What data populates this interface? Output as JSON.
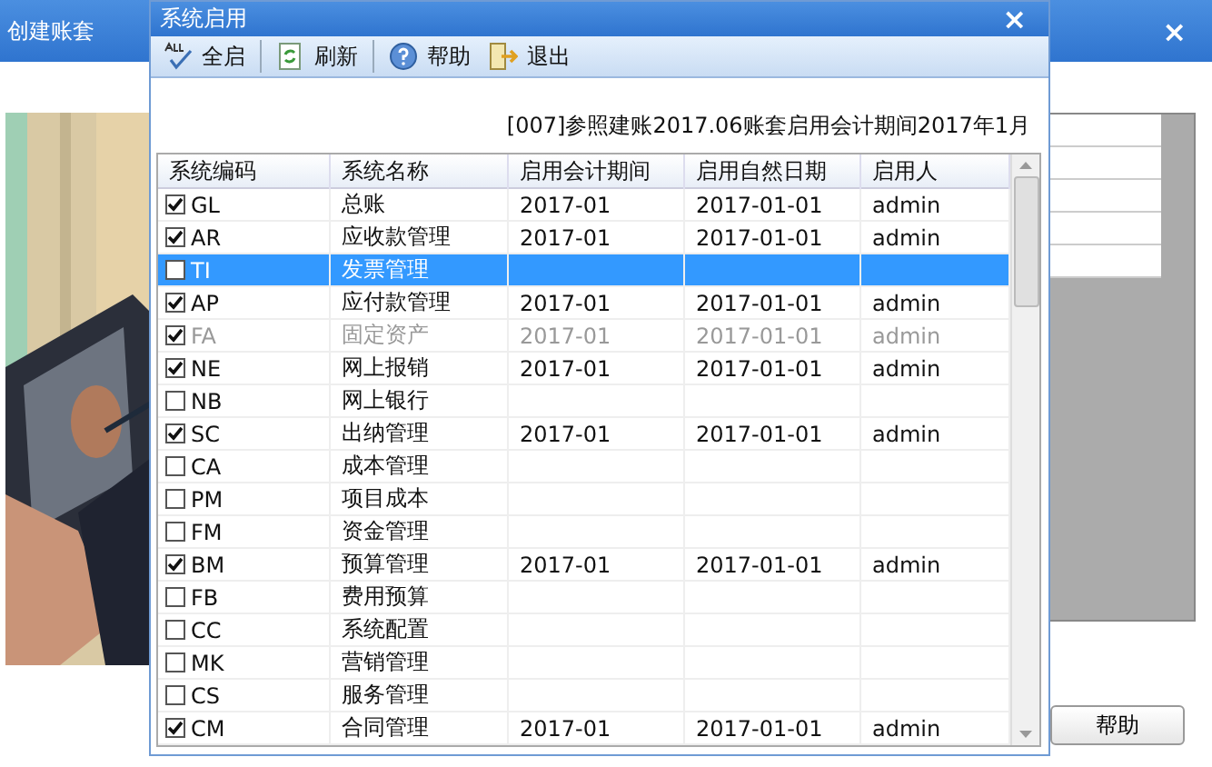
{
  "background_window": {
    "title": "创建账套",
    "close": "×",
    "help_button": "帮助"
  },
  "dialog": {
    "title": "系统启用",
    "close": "×",
    "toolbar": [
      "全启",
      "刷新",
      "帮助",
      "退出"
    ],
    "info": "[007]参照建账2017.06账套启用会计期间2017年1月",
    "table": {
      "columns": [
        "系统编码",
        "系统名称",
        "启用会计期间",
        "启用自然日期",
        "启用人"
      ],
      "rows": [
        {
          "code": "GL",
          "name": "总账",
          "period": "2017-01",
          "date": "2017-01-01",
          "user": "admin",
          "checked": true,
          "selected": false,
          "disabled": false
        },
        {
          "code": "AR",
          "name": "应收款管理",
          "period": "2017-01",
          "date": "2017-01-01",
          "user": "admin",
          "checked": true,
          "selected": false,
          "disabled": false
        },
        {
          "code": "TI",
          "name": "发票管理",
          "checked": false,
          "selected": true,
          "disabled": false
        },
        {
          "code": "AP",
          "name": "应付款管理",
          "period": "2017-01",
          "date": "2017-01-01",
          "user": "admin",
          "checked": true,
          "selected": false,
          "disabled": false
        },
        {
          "code": "FA",
          "name": "固定资产",
          "period": "2017-01",
          "date": "2017-01-01",
          "user": "admin",
          "checked": true,
          "selected": false,
          "disabled": true
        },
        {
          "code": "NE",
          "name": "网上报销",
          "period": "2017-01",
          "date": "2017-01-01",
          "user": "admin",
          "checked": true,
          "selected": false,
          "disabled": false
        },
        {
          "code": "NB",
          "name": "网上银行",
          "checked": false,
          "selected": false,
          "disabled": false
        },
        {
          "code": "SC",
          "name": "出纳管理",
          "period": "2017-01",
          "date": "2017-01-01",
          "user": "admin",
          "checked": true,
          "selected": false,
          "disabled": false
        },
        {
          "code": "CA",
          "name": "成本管理",
          "checked": false,
          "selected": false,
          "disabled": false
        },
        {
          "code": "PM",
          "name": "项目成本",
          "checked": false,
          "selected": false,
          "disabled": false
        },
        {
          "code": "FM",
          "name": "资金管理",
          "checked": false,
          "selected": false,
          "disabled": false
        },
        {
          "code": "BM",
          "name": "预算管理",
          "period": "2017-01",
          "date": "2017-01-01",
          "user": "admin",
          "checked": true,
          "selected": false,
          "disabled": false
        },
        {
          "code": "FB",
          "name": "费用预算",
          "checked": false,
          "selected": false,
          "disabled": false
        },
        {
          "code": "CC",
          "name": "系统配置",
          "checked": false,
          "selected": false,
          "disabled": false
        },
        {
          "code": "MK",
          "name": "营销管理",
          "checked": false,
          "selected": false,
          "disabled": false
        },
        {
          "code": "CS",
          "name": "服务管理",
          "checked": false,
          "selected": false,
          "disabled": false
        },
        {
          "code": "CM",
          "name": "合同管理",
          "period": "2017-01",
          "date": "2017-01-01",
          "user": "admin",
          "checked": true,
          "selected": false,
          "disabled": false
        }
      ]
    }
  }
}
